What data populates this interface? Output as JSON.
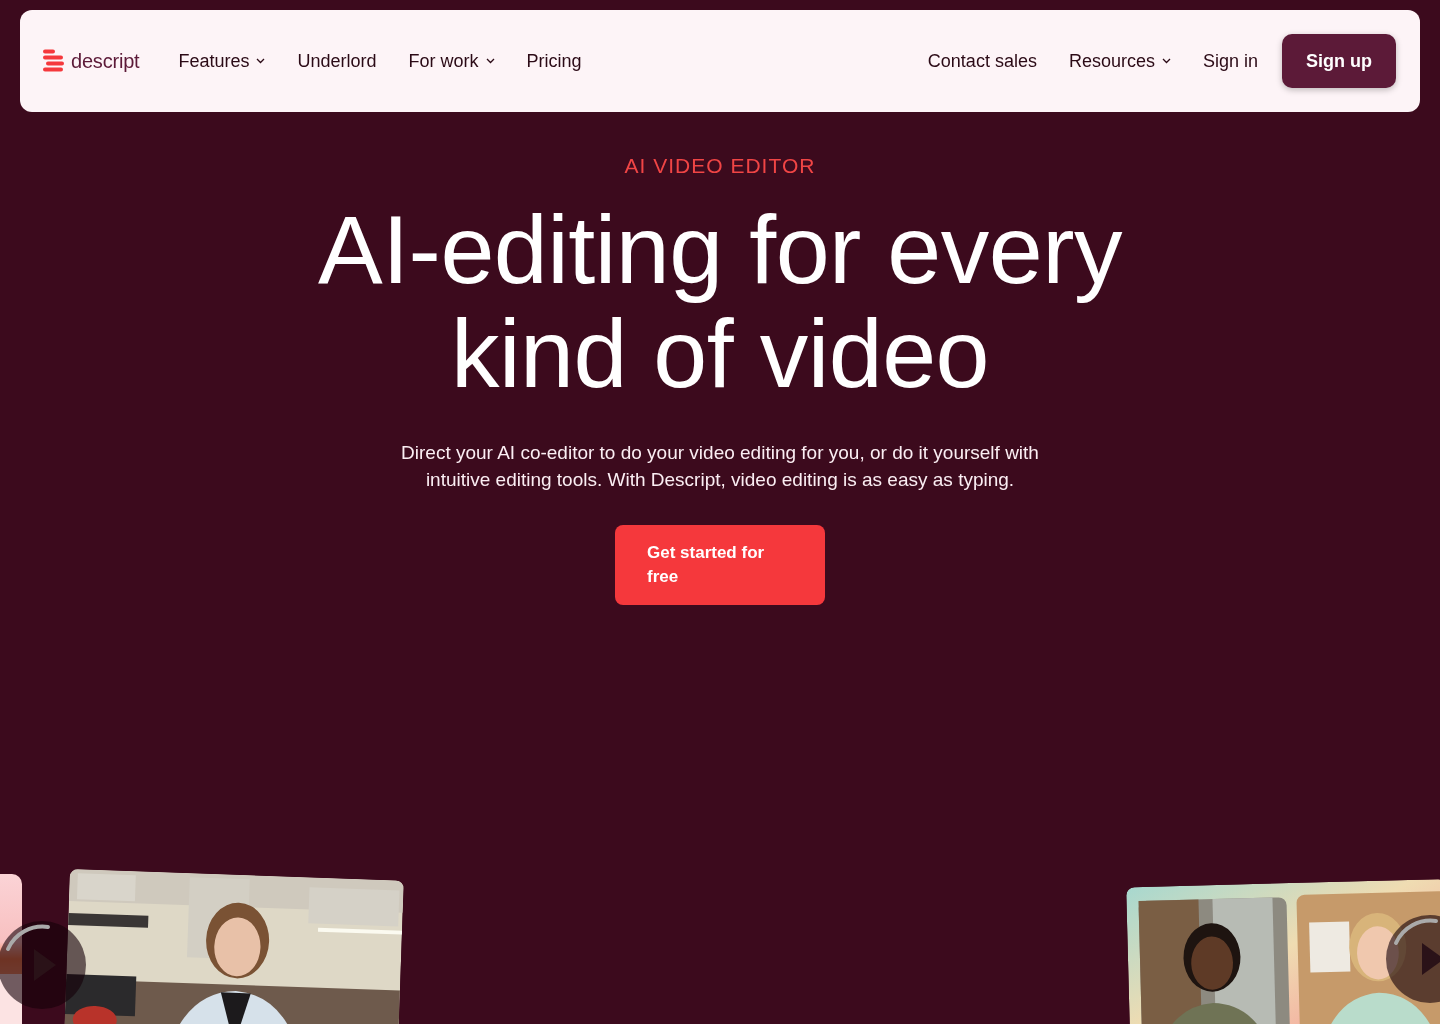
{
  "nav": {
    "logo": "descript",
    "left_items": [
      {
        "label": "Features",
        "dropdown": true
      },
      {
        "label": "Underlord",
        "dropdown": false
      },
      {
        "label": "For work",
        "dropdown": true
      },
      {
        "label": "Pricing",
        "dropdown": false
      }
    ],
    "right_items": [
      {
        "label": "Contact sales",
        "dropdown": false
      },
      {
        "label": "Resources",
        "dropdown": true
      },
      {
        "label": "Sign in",
        "dropdown": false
      }
    ],
    "cta": "Sign up"
  },
  "hero": {
    "eyebrow": "AI VIDEO EDITOR",
    "title": "AI-editing for every kind of video",
    "subtitle": "Direct your AI co-editor to do your video editing for you, or do it yourself with intuitive editing tools. With Descript, video editing is as easy as typing.",
    "button": "Get started for free"
  }
}
